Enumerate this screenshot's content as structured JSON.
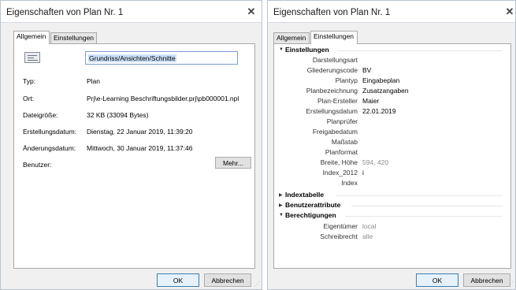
{
  "dialog1": {
    "title": "Eigenschaften von Plan Nr. 1",
    "tabs": [
      {
        "label": "Allgemein"
      },
      {
        "label": "Einstellungen"
      }
    ],
    "name_value": "Grundriss/Ansichten/Schnitte",
    "fields": [
      {
        "label": "Typ:",
        "value": "Plan"
      },
      {
        "label": "Ort:",
        "value": "Prj\\e-Learning Beschriftungsbilder.prj\\pb000001.npl"
      },
      {
        "label": "Dateigröße:",
        "value": "32 KB (33094 Bytes)"
      },
      {
        "label": "Erstellungsdatum:",
        "value": "Dienstag, 22 Januar 2019, 11:39:20"
      },
      {
        "label": "Änderungsdatum:",
        "value": "Mittwoch, 30 Januar 2019, 11:37:46"
      },
      {
        "label": "Benutzer:",
        "value": ""
      }
    ],
    "more_label": "Mehr...",
    "ok_label": "OK",
    "cancel_label": "Abbrechen"
  },
  "dialog2": {
    "title": "Eigenschaften von Plan Nr. 1",
    "tabs": [
      {
        "label": "Allgemein"
      },
      {
        "label": "Einstellungen"
      }
    ],
    "sections": {
      "einstellungen": "Einstellungen",
      "indextabelle": "Indextabelle",
      "benutzerattribute": "Benutzerattribute",
      "berechtigungen": "Berechtigungen"
    },
    "props": [
      {
        "label": "Darstellungsart",
        "value": ""
      },
      {
        "label": "Gliederungscode",
        "value": "BV"
      },
      {
        "label": "Plantyp",
        "value": "Eingabeplan"
      },
      {
        "label": "Planbezeichnung",
        "value": "Zusatzangaben"
      },
      {
        "label": "Plan-Ersteller",
        "value": "Maier"
      },
      {
        "label": "Erstellungsdatum",
        "value": "22.01.2019"
      },
      {
        "label": "Planprüfer",
        "value": ""
      },
      {
        "label": "Freigabedatum",
        "value": ""
      },
      {
        "label": "Maßstab",
        "value": ""
      },
      {
        "label": "Planformat",
        "value": ""
      },
      {
        "label": "Breite, Höhe",
        "value": "594, 420"
      },
      {
        "label": "Index_2012",
        "value": "i"
      },
      {
        "label": "Index",
        "value": ""
      }
    ],
    "rights": [
      {
        "label": "Eigentümer",
        "value": "local"
      },
      {
        "label": "Schreibrecht",
        "value": "alle"
      }
    ],
    "ok_label": "OK",
    "cancel_label": "Abbrechen"
  }
}
